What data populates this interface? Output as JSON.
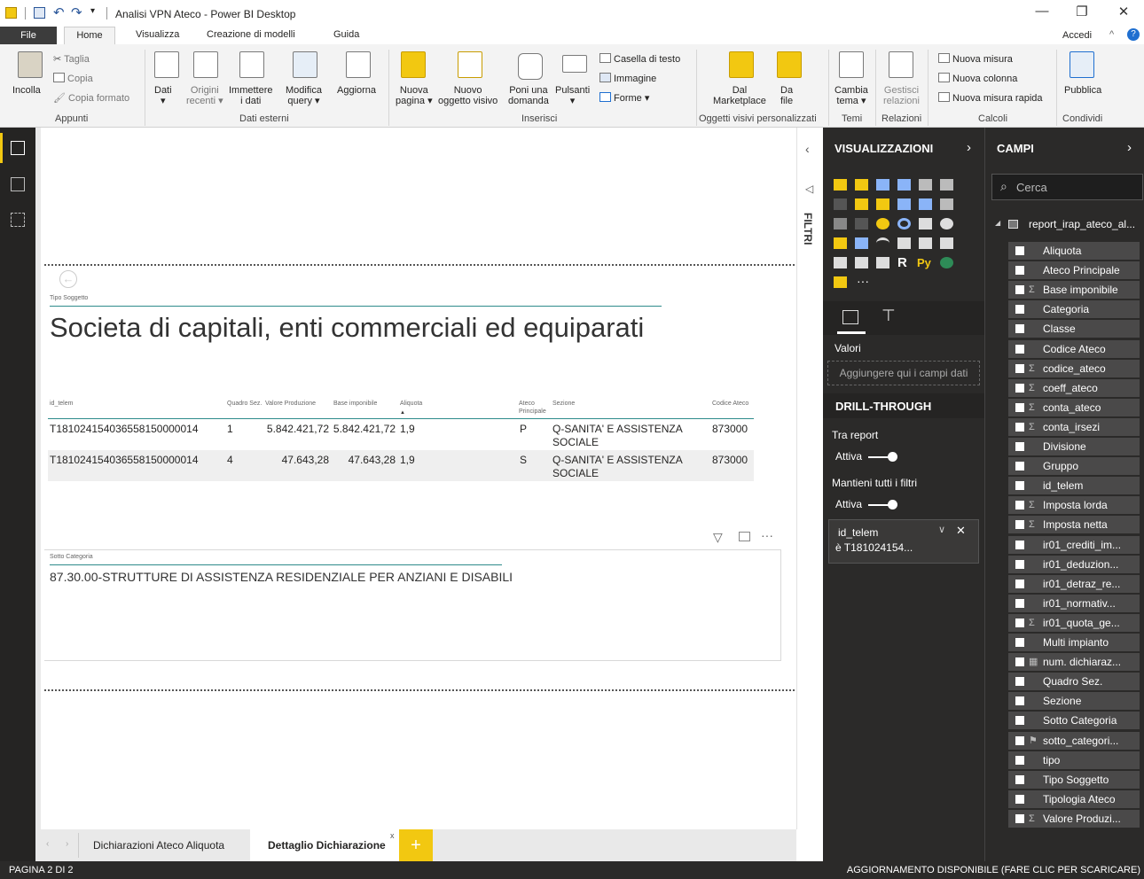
{
  "window": {
    "title": "Analisi VPN Ateco - Power BI Desktop"
  },
  "ribbon_tabs": {
    "file": "File",
    "home": "Home",
    "visualizza": "Visualizza",
    "modelli": "Creazione di modelli",
    "guida": "Guida",
    "accedi": "Accedi"
  },
  "ribbon": {
    "incolla": "Incolla",
    "taglia": "Taglia",
    "copia": "Copia",
    "copia_formato": "Copia formato",
    "appunti": "Appunti",
    "dati": "Dati",
    "origini": "Origini",
    "recenti": "recenti",
    "immettere": "Immettere",
    "i_dati": "i dati",
    "modifica": "Modifica",
    "query": "query",
    "aggiorna": "Aggiorna",
    "dati_esterni": "Dati esterni",
    "nuova": "Nuova",
    "pagina": "pagina",
    "nuovo": "Nuovo",
    "oggetto_visivo": "oggetto visivo",
    "poni_una": "Poni una",
    "domanda": "domanda",
    "pulsanti": "Pulsanti",
    "casella": "Casella di testo",
    "immagine": "Immagine",
    "forme": "Forme",
    "inserisci": "Inserisci",
    "dal": "Dal",
    "marketplace": "Marketplace",
    "da": "Da",
    "file": "file",
    "oggetti_pers": "Oggetti visivi personalizzati",
    "cambia": "Cambia",
    "tema": "tema",
    "temi": "Temi",
    "gestisci": "Gestisci",
    "relazioni": "relazioni",
    "relazioni_grp": "Relazioni",
    "nuova_misura": "Nuova misura",
    "nuova_colonna": "Nuova colonna",
    "nuova_misura_rapida": "Nuova misura rapida",
    "calcoli": "Calcoli",
    "pubblica": "Pubblica",
    "condividi": "Condividi"
  },
  "canvas": {
    "tipo_soggetto_label": "Tipo Soggetto",
    "tipo_soggetto_value": "Societa di capitali, enti commerciali ed equiparati",
    "table": {
      "headers": [
        "id_telem",
        "Quadro Sez.",
        "Valore Produzione",
        "Base imponibile",
        "Aliquota",
        "Ateco Principale",
        "Sezione",
        "Codice Ateco"
      ],
      "rows": [
        [
          "T181024154036558150000014",
          "1",
          "5.842.421,72",
          "5.842.421,72",
          "1,9",
          "P",
          "Q-SANITA' E ASSISTENZA",
          "SOCIALE",
          "873000"
        ],
        [
          "T181024154036558150000014",
          "4",
          "47.643,28",
          "47.643,28",
          "1,9",
          "S",
          "Q-SANITA' E ASSISTENZA",
          "SOCIALE",
          "873000"
        ]
      ]
    },
    "sotto_categoria_label": "Sotto Categoria",
    "sotto_categoria_value": "87.30.00-STRUTTURE DI ASSISTENZA RESIDENZIALE PER ANZIANI E DISABILI"
  },
  "filtri": {
    "label": "FILTRI"
  },
  "viz": {
    "title": "VISUALIZZAZIONI",
    "valori": "Valori",
    "valori_placeholder": "Aggiungere qui i campi dati",
    "drill": "DRILL-THROUGH",
    "tra_report": "Tra report",
    "attiva1": "Attiva",
    "mantieni": "Mantieni tutti i filtri",
    "attiva2": "Attiva",
    "filter_field": "id_telem",
    "filter_value": "è T181024154..."
  },
  "campi": {
    "title": "CAMPI",
    "search_placeholder": "Cerca",
    "table_name": "report_irap_ateco_al...",
    "fields": [
      {
        "n": "Aliquota",
        "s": ""
      },
      {
        "n": "Ateco Principale",
        "s": ""
      },
      {
        "n": "Base imponibile",
        "s": "Σ"
      },
      {
        "n": "Categoria",
        "s": ""
      },
      {
        "n": "Classe",
        "s": ""
      },
      {
        "n": "Codice Ateco",
        "s": ""
      },
      {
        "n": "codice_ateco",
        "s": "Σ"
      },
      {
        "n": "coeff_ateco",
        "s": "Σ"
      },
      {
        "n": "conta_ateco",
        "s": "Σ"
      },
      {
        "n": "conta_irsezi",
        "s": "Σ"
      },
      {
        "n": "Divisione",
        "s": ""
      },
      {
        "n": "Gruppo",
        "s": ""
      },
      {
        "n": "id_telem",
        "s": ""
      },
      {
        "n": "Imposta lorda",
        "s": "Σ"
      },
      {
        "n": "Imposta netta",
        "s": "Σ"
      },
      {
        "n": "ir01_crediti_im...",
        "s": ""
      },
      {
        "n": "ir01_deduzion...",
        "s": ""
      },
      {
        "n": "ir01_detraz_re...",
        "s": ""
      },
      {
        "n": "ir01_normativ...",
        "s": ""
      },
      {
        "n": "ir01_quota_ge...",
        "s": "Σ"
      },
      {
        "n": "Multi impianto",
        "s": ""
      },
      {
        "n": "num. dichiaraz...",
        "s": "▦"
      },
      {
        "n": "Quadro Sez.",
        "s": ""
      },
      {
        "n": "Sezione",
        "s": ""
      },
      {
        "n": "Sotto Categoria",
        "s": ""
      },
      {
        "n": "sotto_categori...",
        "s": "⚑"
      },
      {
        "n": "tipo",
        "s": ""
      },
      {
        "n": "Tipo Soggetto",
        "s": ""
      },
      {
        "n": "Tipologia Ateco",
        "s": ""
      },
      {
        "n": "Valore Produzi...",
        "s": "Σ"
      }
    ]
  },
  "pages": {
    "tab1": "Dichiarazioni Ateco Aliquota",
    "tab2": "Dettaglio Dichiarazione",
    "add": "+"
  },
  "status": {
    "left": "PAGINA 2 DI 2",
    "right": "AGGIORNAMENTO DISPONIBILE (FARE CLIC PER SCARICARE)"
  }
}
